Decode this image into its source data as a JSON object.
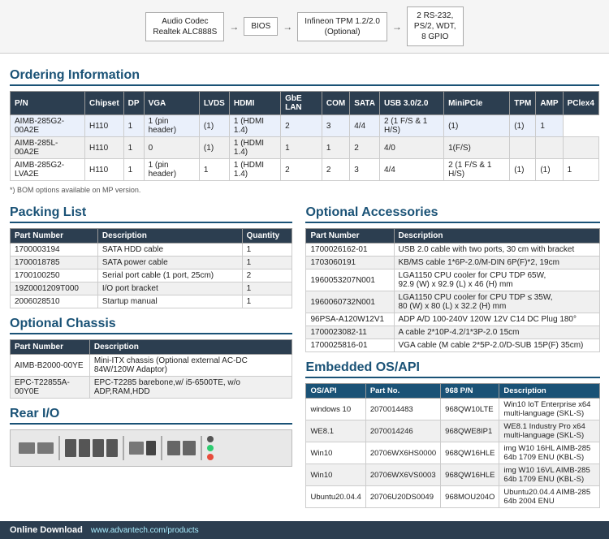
{
  "diagram": {
    "boxes": [
      {
        "label": "Audio Codec\nRealtek ALC888S"
      },
      {
        "label": "BIOS"
      },
      {
        "label": "Infineon TPM 1.2/2.0\n(Optional)"
      },
      {
        "label": "2 RS-232,\nPS/2, WDT,\n8 GPIO"
      }
    ]
  },
  "ordering": {
    "title": "Ordering Information",
    "headers": [
      "P/N",
      "Chipset",
      "DP",
      "VGA",
      "LVDS",
      "HDMI",
      "GbE LAN",
      "COM",
      "SATA",
      "USB 3.0/2.0",
      "MiniPCle",
      "TPM",
      "AMP",
      "PClex4"
    ],
    "rows": [
      [
        "AIMB-285G2-00A2E",
        "H110",
        "1",
        "1 (pin header)",
        "(1)",
        "1 (HDMI 1.4)",
        "2",
        "3",
        "4/4",
        "2 (1 F/S & 1 H/S)",
        "(1)",
        "(1)",
        "1"
      ],
      [
        "AIMB-285L-00A2E",
        "H110",
        "1",
        "0",
        "(1)",
        "1 (HDMI 1.4)",
        "1",
        "1",
        "2",
        "4/0",
        "1(F/S)",
        "",
        "",
        ""
      ],
      [
        "AIMB-285G2-LVA2E",
        "H110",
        "1",
        "1 (pin header)",
        "1",
        "1 (HDMI 1.4)",
        "2",
        "2",
        "3",
        "4/4",
        "2 (1 F/S & 1 H/S)",
        "(1)",
        "(1)",
        "1"
      ]
    ],
    "footnote": "*) BOM options available on MP version."
  },
  "packing": {
    "title": "Packing List",
    "headers": [
      "Part Number",
      "Description",
      "Quantity"
    ],
    "rows": [
      [
        "1700003194",
        "SATA HDD cable",
        "1"
      ],
      [
        "1700018785",
        "SATA power cable",
        "1"
      ],
      [
        "1700100250",
        "Serial port cable (1 port, 25cm)",
        "2"
      ],
      [
        "19Z0001209T000",
        "I/O port bracket",
        "1"
      ],
      [
        "2006028510",
        "Startup manual",
        "1"
      ]
    ]
  },
  "optional_chassis": {
    "title": "Optional Chassis",
    "headers": [
      "Part Number",
      "Description"
    ],
    "rows": [
      [
        "AIMB-B2000-00YE",
        "Mini-ITX chassis (Optional external AC-DC 84W/120W Adaptor)"
      ],
      [
        "EPC-T22855A-00Y0E",
        "EPC-T2285 barebone,w/ i5-6500TE, w/o ADP,RAM,HDD"
      ]
    ]
  },
  "rear_io": {
    "title": "Rear I/O"
  },
  "optional_accessories": {
    "title": "Optional Accessories",
    "headers": [
      "Part Number",
      "Description"
    ],
    "rows": [
      [
        "1700026162-01",
        "USB 2.0 cable with two ports, 30 cm with bracket"
      ],
      [
        "1703060191",
        "KB/MS cable 1*6P-2.0/M-DIN 6P(F)*2, 19cm"
      ],
      [
        "1960053207N001",
        "LGA1150 CPU cooler for CPU TDP 65W,\n92.9 (W) x 92.9 (L) x 46 (H) mm"
      ],
      [
        "1960060732N001",
        "LGA1150 CPU cooler for CPU TDP ≤ 35W,\n80 (W) x 80 (L) x 32.2 (H) mm"
      ],
      [
        "96PSA-A120W12V1",
        "ADP A/D 100-240V 120W 12V C14 DC Plug 180°"
      ],
      [
        "1700023082-11",
        "A cable 2*10P-4.2/1*3P-2.0 15cm"
      ],
      [
        "1700025816-01",
        "VGA cable (M cable 2*5P-2.0/D-SUB 15P(F) 35cm)"
      ]
    ]
  },
  "embedded_os": {
    "title": "Embedded OS/API",
    "headers": [
      "OS/API",
      "Part No.",
      "968 P/N",
      "Description"
    ],
    "rows": [
      [
        "windows 10",
        "2070014483",
        "968QW10LTE",
        "Win10 IoT Enterprise x64 multi-language (SKL-S)"
      ],
      [
        "WE8.1",
        "2070014246",
        "968QWE8IP1",
        "WE8.1 Industry Pro x64 multi-language (SKL-S)"
      ],
      [
        "Win10",
        "20706WX6HS0000",
        "968QW16HLE",
        "img W10 16HL AIMB-285 64b 1709 ENU (KBL-S)"
      ],
      [
        "Win10",
        "20706WX6VS0003",
        "968QW16HLE",
        "img W10 16VL AIMB-285 64b 1709 ENU (KBL-S)"
      ],
      [
        "Ubuntu20.04.4",
        "20706U20DS0049",
        "968MOU204O",
        "Ubuntu20.04.4 AIMB-285 64b 2004 ENU"
      ]
    ]
  },
  "bottom": {
    "label": "Online Download",
    "url": "www.advantech.com/products"
  }
}
